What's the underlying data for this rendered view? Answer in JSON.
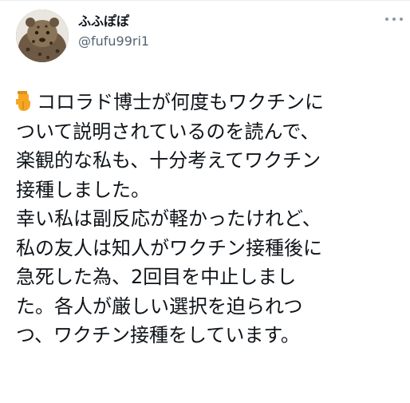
{
  "author": {
    "display_name": "ふふぽぽ",
    "username": "@fufu99ri1",
    "avatar_icon": "leopard-plush-avatar"
  },
  "actions": {
    "more_icon": "more-dots-icon"
  },
  "tweet": {
    "leading_emoji_icon": "pointing-down-hand-icon",
    "lines": [
      "コロラド博士が何度もワクチンに",
      "ついて説明されているのを読んで、",
      "楽観的な私も、十分考えてワクチン",
      "接種しました。",
      "幸い私は副反応が軽かったけれど、",
      "私の友人は知人がワクチン接種後に",
      "急死した為、2回目を中止しまし",
      "た。各人が厳しい選択を迫られつ",
      "つ、ワクチン接種をしています。"
    ]
  },
  "colors": {
    "text": "#0f1419",
    "secondary_text": "#536471",
    "emoji": "#f6a623"
  }
}
